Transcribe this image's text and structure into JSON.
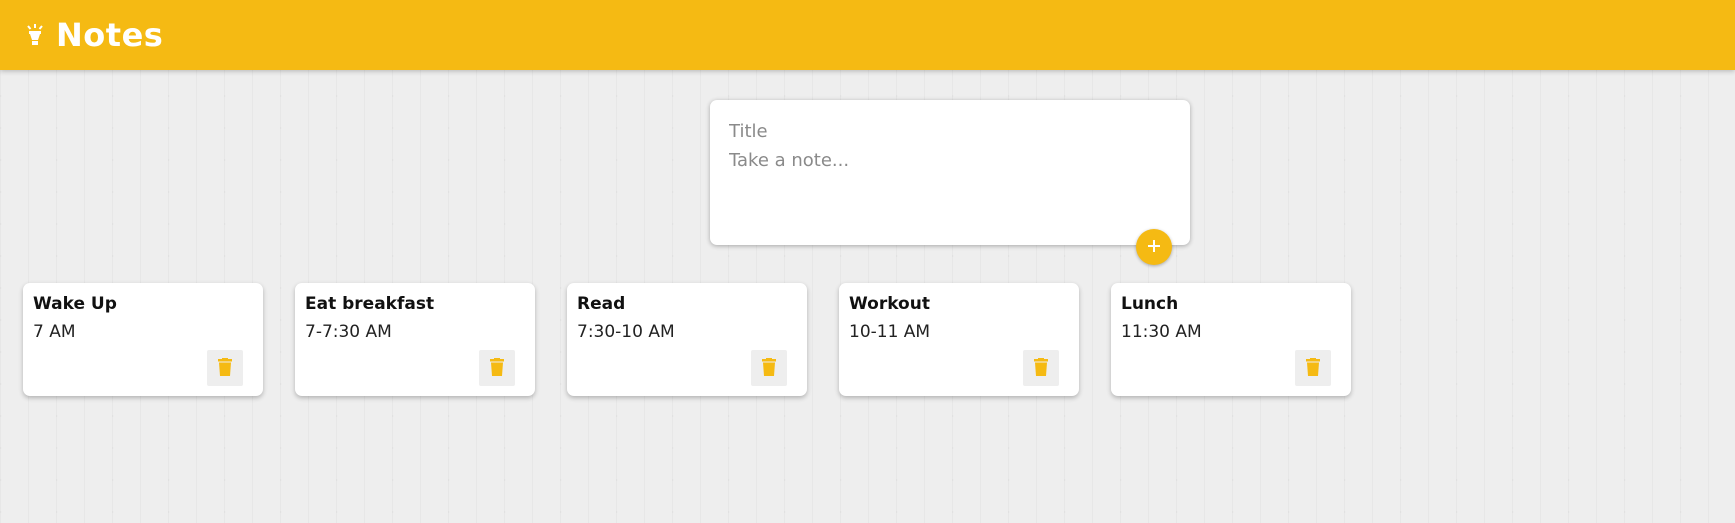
{
  "header": {
    "title": "Notes",
    "logo_icon": "lightbulb-icon",
    "accent_color": "#f5ba13"
  },
  "composer": {
    "title_placeholder": "Title",
    "content_placeholder": "Take a note...",
    "add_icon": "plus-icon"
  },
  "notes": [
    {
      "title": "Wake Up",
      "content": "7 AM"
    },
    {
      "title": "Eat breakfast",
      "content": "7-7:30 AM"
    },
    {
      "title": "Read",
      "content": "7:30-10 AM"
    },
    {
      "title": "Workout",
      "content": "10-11 AM"
    },
    {
      "title": "Lunch",
      "content": "11:30 AM"
    }
  ],
  "delete_icon": "trash-icon"
}
